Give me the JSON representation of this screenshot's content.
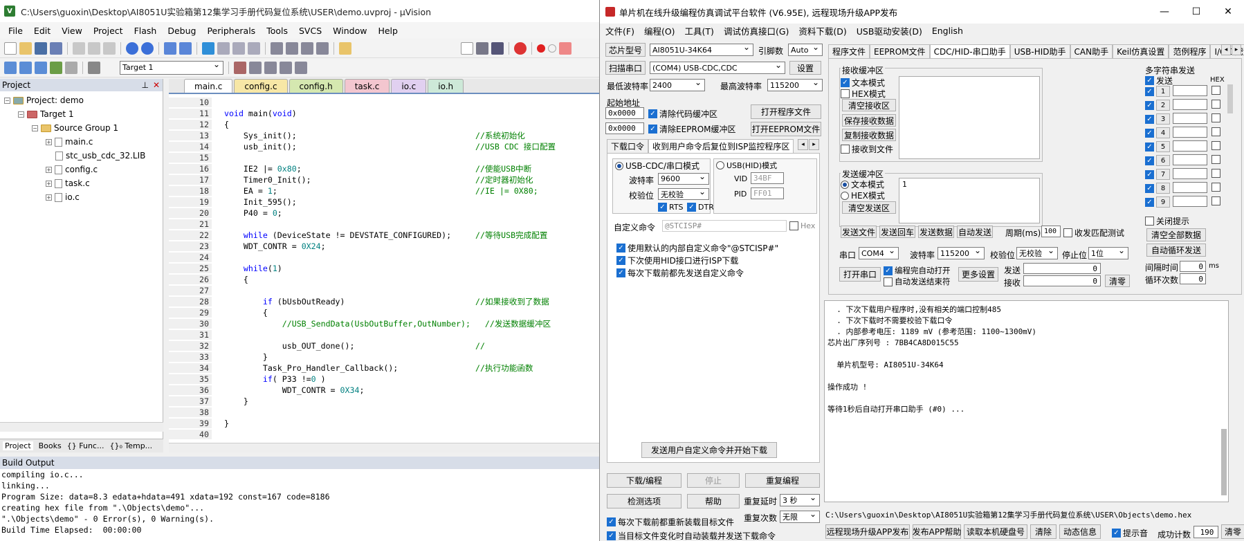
{
  "uvision": {
    "title": "C:\\Users\\guoxin\\Desktop\\AI8051U实验箱第12集学习手册代码复位系统\\USER\\demo.uvproj - µVision",
    "menu": [
      "File",
      "Edit",
      "View",
      "Project",
      "Flash",
      "Debug",
      "Peripherals",
      "Tools",
      "SVCS",
      "Window",
      "Help"
    ],
    "target": "Target 1",
    "project_panel_title": "Project",
    "tree": {
      "project": "Project: demo",
      "target": "Target 1",
      "group": "Source Group 1",
      "files": [
        "main.c",
        "stc_usb_cdc_32.LIB",
        "config.c",
        "task.c",
        "io.c"
      ]
    },
    "panel_tabs": [
      "Project",
      "Books",
      "{} Func...",
      "{}₀ Temp..."
    ],
    "editor_tabs": [
      "main.c",
      "config.c",
      "config.h",
      "task.c",
      "io.c",
      "io.h"
    ],
    "code": [
      {
        "n": "10",
        "t": ""
      },
      {
        "n": "11",
        "t": "void main(void)"
      },
      {
        "n": "12",
        "t": "{"
      },
      {
        "n": "13",
        "t": "    Sys_init();                                     //系统初始化"
      },
      {
        "n": "14",
        "t": "    usb_init();                                     //USB CDC 接口配置"
      },
      {
        "n": "15",
        "t": ""
      },
      {
        "n": "16",
        "t": "    IE2 |= 0x80;                                    //使能USB中断"
      },
      {
        "n": "17",
        "t": "    Timer0_Init();                                  //定时器初始化"
      },
      {
        "n": "18",
        "t": "    EA = 1;                                         //IE |= 0X80;"
      },
      {
        "n": "19",
        "t": "    Init_595();"
      },
      {
        "n": "20",
        "t": "    P40 = 0;"
      },
      {
        "n": "21",
        "t": ""
      },
      {
        "n": "22",
        "t": "    while (DeviceState != DEVSTATE_CONFIGURED);     //等待USB完成配置"
      },
      {
        "n": "23",
        "t": "    WDT_CONTR = 0X24;"
      },
      {
        "n": "24",
        "t": ""
      },
      {
        "n": "25",
        "t": "    while(1)"
      },
      {
        "n": "26",
        "t": "    {"
      },
      {
        "n": "27",
        "t": ""
      },
      {
        "n": "28",
        "t": "        if (bUsbOutReady)                           //如果接收到了数据"
      },
      {
        "n": "29",
        "t": "        {"
      },
      {
        "n": "30",
        "t": "            //USB_SendData(UsbOutBuffer,OutNumber);   //发送数据缓冲区"
      },
      {
        "n": "31",
        "t": ""
      },
      {
        "n": "32",
        "t": "            usb_OUT_done();                         //"
      },
      {
        "n": "33",
        "t": "        }"
      },
      {
        "n": "34",
        "t": "        Task_Pro_Handler_Callback();                //执行功能函数"
      },
      {
        "n": "35",
        "t": "        if( P33 !=0 )"
      },
      {
        "n": "36",
        "t": "            WDT_CONTR = 0X34;"
      },
      {
        "n": "37",
        "t": "    }"
      },
      {
        "n": "38",
        "t": ""
      },
      {
        "n": "39",
        "t": "}"
      },
      {
        "n": "40",
        "t": ""
      }
    ],
    "build_output_title": "Build Output",
    "build_output": "compiling io.c...\nlinking...\nProgram Size: data=8.3 edata+hdata=491 xdata=192 const=167 code=8186\ncreating hex file from \".\\Objects\\demo\"...\n\".\\Objects\\demo\" - 0 Error(s), 0 Warning(s).\nBuild Time Elapsed:  00:00:00"
  },
  "stc": {
    "title": "单片机在线升级编程仿真调试平台软件 (V6.95E), 远程现场升级APP发布",
    "menu": [
      "文件(F)",
      "编程(O)",
      "工具(T)",
      "调试仿真接口(G)",
      "资料下载(D)",
      "USB驱动安装(D)",
      "English"
    ],
    "chip_label": "芯片型号",
    "chip": "AI8051U-34K64",
    "osc_label": "引脚数",
    "osc": "Auto",
    "scan_btn": "扫描串口",
    "port": "(COM4) USB-CDC,CDC",
    "settings_btn": "设置",
    "min_baud_label": "最低波特率",
    "min_baud": "2400",
    "max_baud_label": "最高波特率",
    "max_baud": "115200",
    "start_addr_label": "起始地址",
    "addr1": "0x0000",
    "addr2": "0x0000",
    "clear_code": "清除代码缓冲区",
    "clear_eeprom": "清除EEPROM缓冲区",
    "open_prog": "打开程序文件",
    "open_eeprom": "打开EEPROM文件",
    "dl_tabs": [
      "下载口令",
      "收到用户命令后复位到ISP监控程序区"
    ],
    "usbcdc_mode": "USB-CDC/串口模式",
    "usbhid_mode": "USB(HID)模式",
    "baud_label": "波特率",
    "baud": "9600",
    "parity_label": "校验位",
    "parity": "无校验",
    "rts": "RTS",
    "dtr": "DTR",
    "vid_label": "VID",
    "vid": "34BF",
    "pid_label": "PID",
    "pid": "FF01",
    "custom_cmd_label": "自定义命令",
    "custom_cmd": "@STCISP#",
    "hex_label": "Hex",
    "opt1": "使用默认的内部自定义命令\"@STCISP#\"",
    "opt2": "下次使用HID接口进行ISP下载",
    "opt3": "每次下载前都先发送自定义命令",
    "send_custom_btn": "发送用户自定义命令并开始下载",
    "download_btn": "下载/编程",
    "stop_btn": "停止",
    "reprog_btn": "重复编程",
    "check_btn": "检测选项",
    "help_btn": "帮助",
    "delay_label": "重复延时",
    "delay": "3 秒",
    "count_label": "重复次数",
    "count": "无限",
    "reload1": "每次下载前都重新装载目标文件",
    "reload2": "当目标文件变化时自动装载并发送下载命令",
    "right_tabs": [
      "程序文件",
      "EEPROM文件",
      "CDC/HID-串口助手",
      "USB-HID助手",
      "CAN助手",
      "Keil仿真设置",
      "范例程序",
      "I/O口配置"
    ],
    "recv_buf": "接收缓冲区",
    "text_mode": "文本模式",
    "hex_mode": "HEX模式",
    "clear_recv": "清空接收区",
    "save_recv": "保存接收数据",
    "copy_recv": "复制接收数据",
    "recv_to_file": "接收到文件",
    "send_buf": "发送缓冲区",
    "send_text": "1",
    "clear_send": "清空发送区",
    "send_file": "发送文件",
    "send_cr": "发送回车",
    "send_data": "发送数据",
    "auto_send": "自动发送",
    "period_label": "周期(ms)",
    "period": "100",
    "match_test": "收发匹配测试",
    "multi_title": "多字符串发送",
    "multi_send": "发送",
    "multi_hex": "HEX",
    "multi_items": [
      "1",
      "2",
      "3",
      "4",
      "5",
      "6",
      "7",
      "8",
      "9"
    ],
    "close_tip": "关闭提示",
    "clear_all": "清空全部数据",
    "auto_loop": "自动循环发送",
    "interval_label": "间隔时间",
    "interval": "0",
    "interval_unit": "ms",
    "loop_label": "循环次数",
    "loop": "0",
    "com_label": "串口",
    "com": "COM4",
    "baud2_label": "波特率",
    "baud2": "115200",
    "parity2_label": "校验位",
    "parity2": "无校验",
    "stop_label": "停止位",
    "stop": "1位",
    "open_port": "打开串口",
    "auto_open": "编程完自动打开",
    "auto_close": "自动发送结束符",
    "more_set": "更多设置",
    "tx_label": "发送",
    "tx": "0",
    "rx_label": "接收",
    "rx": "0",
    "clear_cnt": "清零",
    "log": [
      "  . 下次下载用户程序时,没有相关的端口控制485",
      "  . 下次下载时不需要校验下载口令",
      "  . 内部参考电压: 1189 mV (参考范围: 1100~1300mV)",
      "芯片出厂序列号 : 7BB4CA8D015C55",
      "",
      "  单片机型号: AI8051U-34K64",
      "",
      "操作成功 !",
      "",
      "等待1秒后自动打开串口助手 (#0) ..."
    ],
    "path": "C:\\Users\\guoxin\\Desktop\\AI8051U实验箱第12集学习手册代码复位系统\\USER\\Objects\\demo.hex",
    "bottom": {
      "remote": "远程现场升级APP发布",
      "app_help": "发布APP帮助",
      "read_hd": "读取本机硬盘号",
      "clear": "清除",
      "anim": "动态信息",
      "tip_sound": "提示音",
      "success_label": "成功计数",
      "success": "190",
      "clear2": "清零"
    }
  }
}
